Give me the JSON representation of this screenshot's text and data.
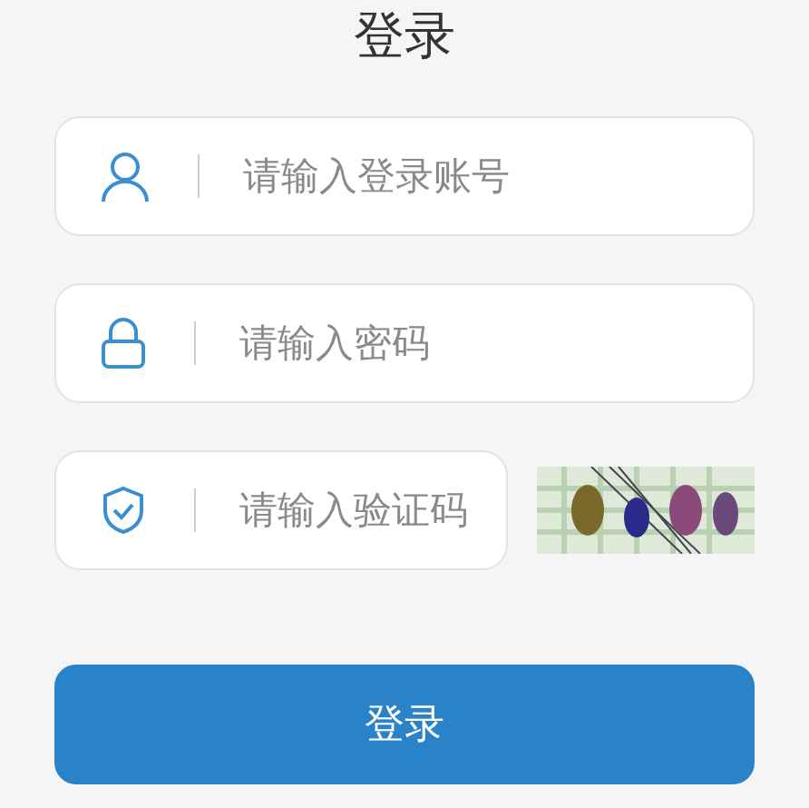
{
  "title": "登录",
  "fields": [
    {
      "kind": "user",
      "placeholder": "请输入登录账号"
    },
    {
      "kind": "lock",
      "placeholder": "请输入密码"
    },
    {
      "kind": "shield",
      "placeholder": "请输入验证码"
    }
  ],
  "submit": {
    "label": "登录"
  }
}
